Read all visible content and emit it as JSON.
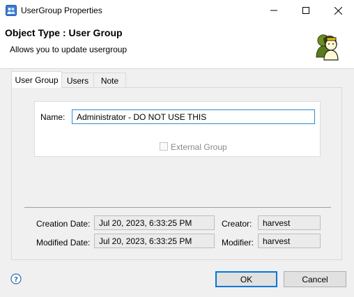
{
  "window": {
    "title": "UserGroup Properties",
    "icons": {
      "app": "app-icon",
      "minimize": "minimize-icon",
      "maximize": "maximize-icon",
      "close": "close-icon"
    }
  },
  "header": {
    "object_type": "Object Type : User Group",
    "description": "Allows you to update usergroup",
    "icon": "user-group-icon"
  },
  "tabs": [
    {
      "label": "User Group",
      "active": true
    },
    {
      "label": "Users",
      "active": false
    },
    {
      "label": "Note",
      "active": false
    }
  ],
  "form": {
    "name_label": "Name:",
    "name_value": "Administrator - DO NOT USE THIS",
    "external_group_label": "External Group",
    "external_group_checked": false,
    "external_group_enabled": false
  },
  "info": {
    "creation_date_label": "Creation Date:",
    "creation_date": "Jul 20, 2023, 6:33:25 PM",
    "creator_label": "Creator:",
    "creator": "harvest",
    "modified_date_label": "Modified Date:",
    "modified_date": "Jul 20, 2023, 6:33:25 PM",
    "modifier_label": "Modifier:",
    "modifier": "harvest"
  },
  "buttons": {
    "ok": "OK",
    "cancel": "Cancel",
    "help_icon": "help-icon"
  },
  "colors": {
    "focus_border": "#0078d7",
    "input_focus": "#2b8ccf"
  }
}
